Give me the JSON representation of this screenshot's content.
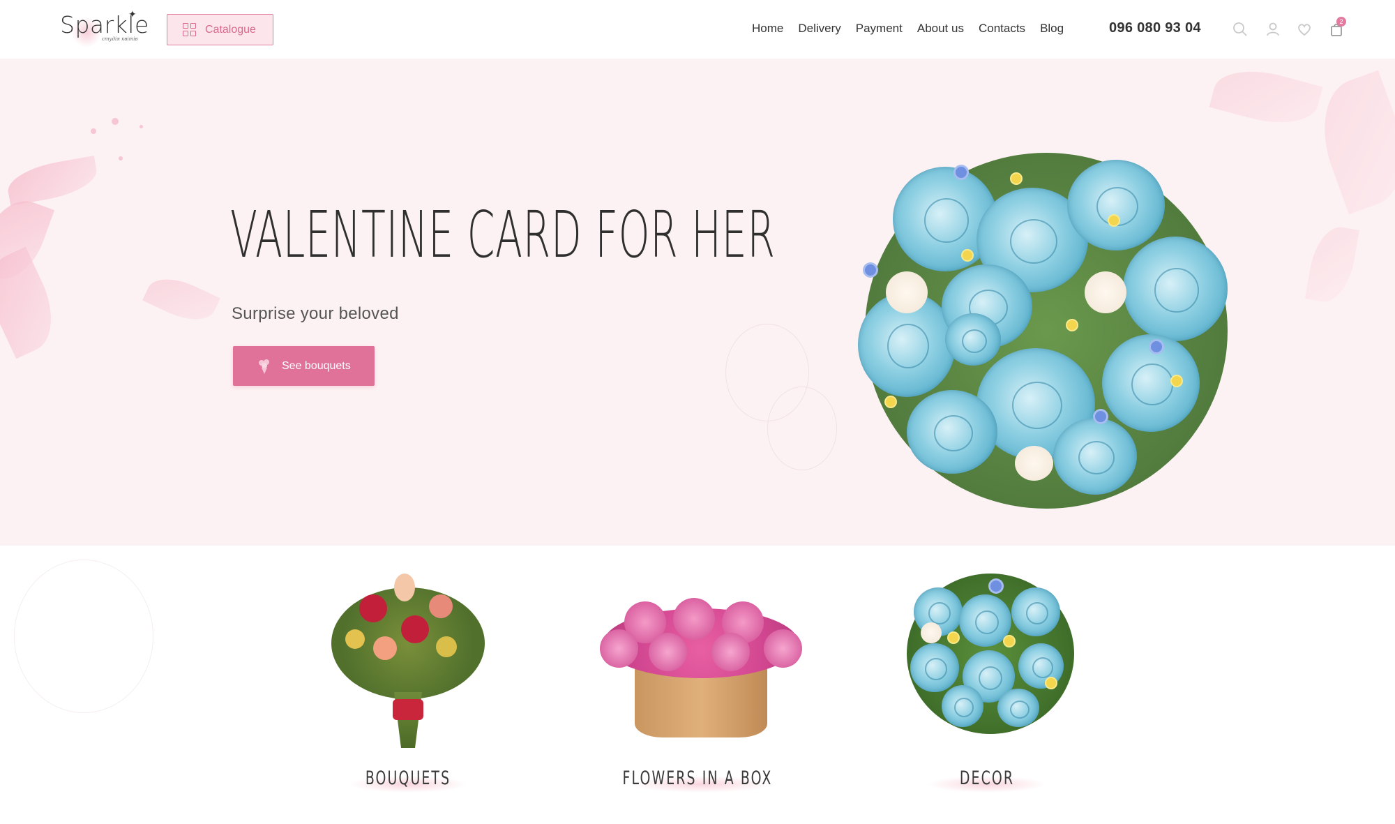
{
  "header": {
    "logo_text": "Sparkle",
    "logo_sub": "студія квітів",
    "catalogue_label": "Catalogue",
    "nav": [
      "Home",
      "Delivery",
      "Payment",
      "About us",
      "Contacts",
      "Blog"
    ],
    "phone": "096 080 93 04",
    "cart_count": "2",
    "icons": [
      "search-icon",
      "user-icon",
      "heart-icon",
      "cart-icon"
    ]
  },
  "hero": {
    "title": "Valentine card for her",
    "subtitle": "Surprise your beloved",
    "button_label": "See bouquets"
  },
  "categories": [
    {
      "label": "Bouquets"
    },
    {
      "label": "Flowers in a box"
    },
    {
      "label": "Decor"
    }
  ],
  "colors": {
    "accent": "#e07199",
    "hero_bg": "#fdf2f3",
    "catalogue_bg": "#fce6ec"
  }
}
